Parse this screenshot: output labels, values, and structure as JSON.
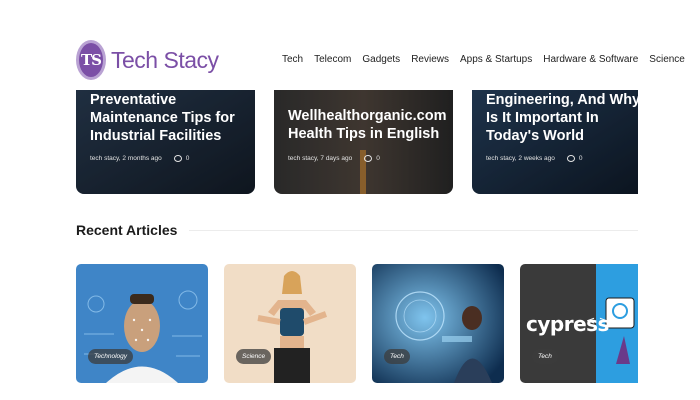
{
  "header": {
    "logo_text": "Tech Stacy",
    "logo_badge": "TS",
    "nav": [
      "Tech",
      "Telecom",
      "Gadgets",
      "Reviews",
      "Apps & Startups",
      "Hardware & Software",
      "Science"
    ]
  },
  "featured": [
    {
      "title": "Preventative Maintenance Tips for Industrial Facilities",
      "author_time": "tech stacy, 2 months ago",
      "comments": "0"
    },
    {
      "title": "Wellhealthorganic.com Health Tips in English",
      "author_time": "tech stacy, 7 days ago",
      "comments": "0"
    },
    {
      "title": "Engineering, And Why Is It Important In Today's World",
      "author_time": "tech stacy, 2 weeks ago",
      "comments": "0"
    }
  ],
  "recent": {
    "title": "Recent Articles",
    "cards": [
      {
        "tag": "Technology"
      },
      {
        "tag": "Science"
      },
      {
        "tag": "Tech"
      },
      {
        "tag": "Tech",
        "image_text": "cypress"
      }
    ]
  },
  "colors": {
    "brand": "#7b4fa6",
    "card_dark": "#1d2a3a"
  }
}
